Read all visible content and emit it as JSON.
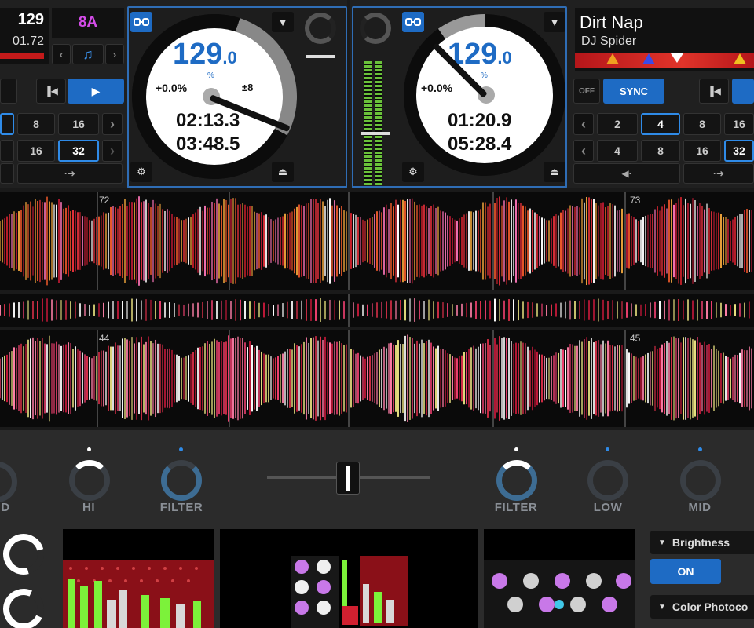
{
  "deck_left": {
    "bpm_small": "129",
    "time_small": "01.72",
    "key": "8A",
    "platter": {
      "bpm_int": "129",
      "bpm_dec": ".0",
      "bpm_unit": "%",
      "pitch": "+0.0%",
      "pitch_range": "±8",
      "elapsed": "02:13.3",
      "remaining": "03:48.5"
    },
    "loop_row1": [
      "8",
      "16"
    ],
    "loop_row2": [
      "16",
      "32"
    ],
    "selected_loop": "32"
  },
  "deck_right": {
    "title": "Dirt Nap",
    "artist": "DJ Spider",
    "platter": {
      "bpm_int": "129",
      "bpm_dec": ".0",
      "bpm_unit": "%",
      "pitch": "+0.0%",
      "elapsed": "01:20.9",
      "remaining": "05:28.4"
    },
    "off_label": "OFF",
    "sync_label": "SYNC",
    "loop_row1": [
      "2",
      "4",
      "8",
      "16"
    ],
    "loop_row2": [
      "4",
      "8",
      "16",
      "32"
    ]
  },
  "waveform": {
    "top_markers": [
      "72",
      "73"
    ],
    "bottom_markers": [
      "44",
      "45"
    ]
  },
  "mixer": {
    "labels_left": [
      "D",
      "HI",
      "FILTER"
    ],
    "labels_right": [
      "FILTER",
      "LOW",
      "MID"
    ]
  },
  "effects": {
    "brightness_label": "Brightness",
    "on_label": "ON",
    "color_label": "Color Photoco"
  },
  "colors": {
    "accent": "#1e6bc4",
    "deck_border": "#2f6db5",
    "key_text": "#d44ce8"
  }
}
